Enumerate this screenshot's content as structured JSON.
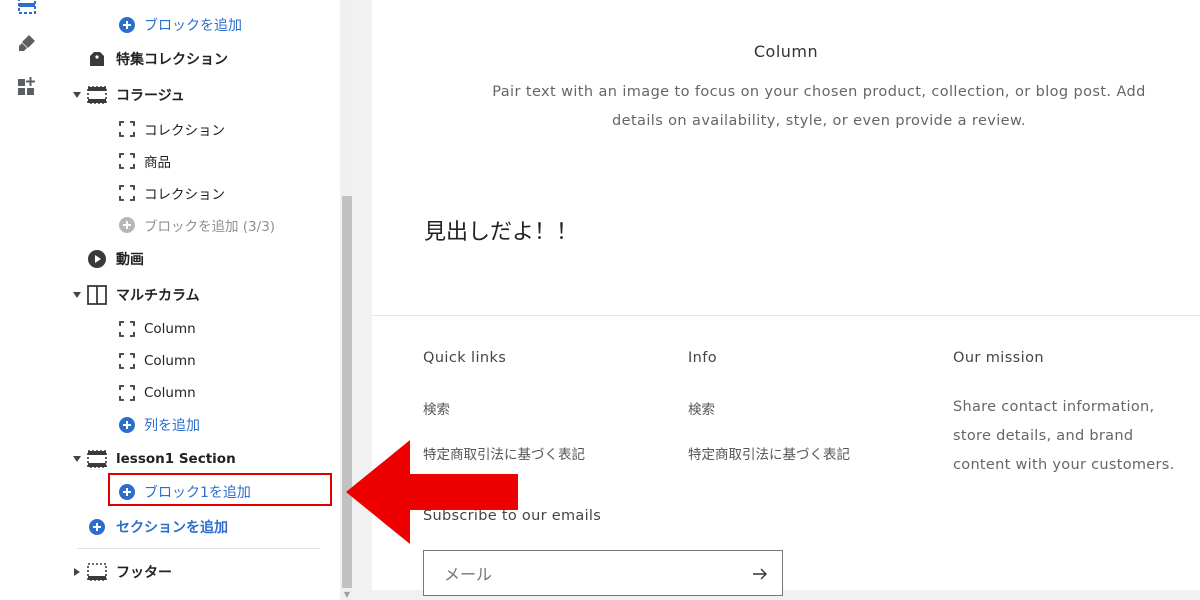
{
  "rail": {
    "icons": [
      "sections-icon",
      "brush-icon",
      "apps-add-icon"
    ],
    "accent": "#2c6ecb"
  },
  "sidebar": {
    "add_block_top": "ブロックを追加",
    "featured_collection": "特集コレクション",
    "collage": {
      "label": "コラージュ",
      "children": [
        "コレクション",
        "商品",
        "コレクション"
      ],
      "add_block": "ブロックを追加 (3/3)"
    },
    "video": "動画",
    "multicolumn": {
      "label": "マルチカラム",
      "children": [
        "Column",
        "Column",
        "Column"
      ],
      "add_column": "列を追加"
    },
    "lesson_section": {
      "label": "lesson1 Section",
      "add_block": "ブロック1を追加"
    },
    "add_section": "セクションを追加",
    "footer": "フッター"
  },
  "colors": {
    "highlight": "#e00000",
    "arrow": "#ee0000",
    "link_blue": "#2c6ecb"
  },
  "preview": {
    "column_title": "Column",
    "column_text": "Pair text with an image to focus on your chosen product, collection, or blog post. Add details on availability, style, or even provide a review.",
    "heading": "見出しだよ！！",
    "footer": {
      "quick_links": {
        "title": "Quick links",
        "links": [
          "検索",
          "特定商取引法に基づく表記"
        ]
      },
      "info": {
        "title": "Info",
        "links": [
          "検索",
          "特定商取引法に基づく表記"
        ]
      },
      "mission": {
        "title": "Our mission",
        "text": "Share contact information, store details, and brand content with your customers."
      },
      "subscribe": {
        "title": "Subscribe to our emails",
        "placeholder": "メール"
      }
    }
  }
}
